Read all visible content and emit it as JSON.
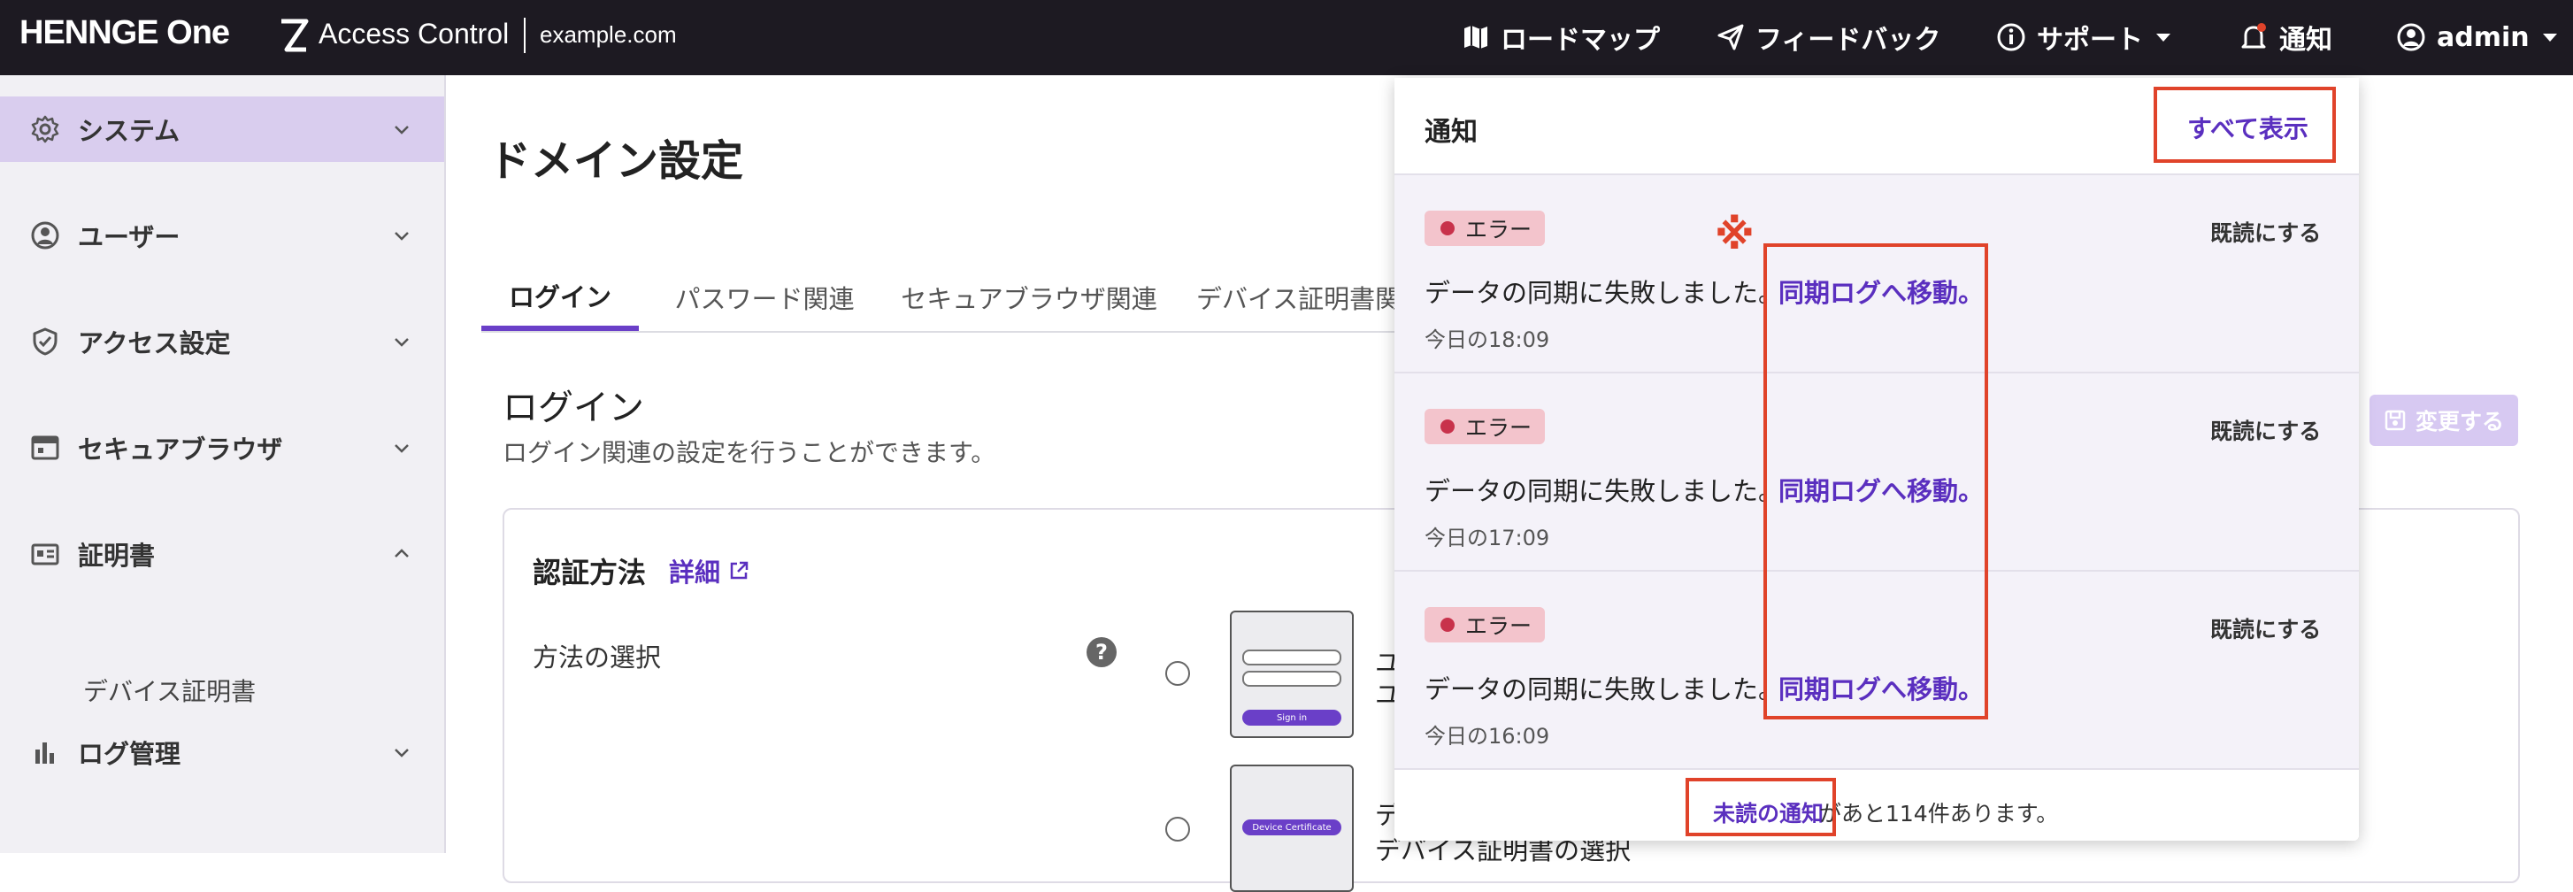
{
  "header": {
    "logo": "HENNGE One",
    "app_name": "Access Control",
    "domain": "example.com",
    "roadmap": "ロードマップ",
    "feedback": "フィードバック",
    "support": "サポート",
    "notifications": "通知",
    "user": "admin"
  },
  "sidebar": {
    "items": [
      {
        "label": "システム",
        "icon": "gear-icon"
      },
      {
        "label": "ユーザー",
        "icon": "user-circle-icon"
      },
      {
        "label": "アクセス設定",
        "icon": "shield-check-icon"
      },
      {
        "label": "セキュアブラウザ",
        "icon": "browser-window-icon"
      },
      {
        "label": "証明書",
        "icon": "id-card-icon"
      },
      {
        "label": "ログ管理",
        "icon": "bar-chart-icon"
      }
    ],
    "sub_item": "デバイス証明書"
  },
  "main": {
    "page_title": "ドメイン設定",
    "tabs": [
      "ログイン",
      "パスワード関連",
      "セキュアブラウザ関連",
      "デバイス証明書関"
    ],
    "section_title": "ログイン",
    "section_desc": "ログイン関連の設定を行うことができます。",
    "save_button": "変更する",
    "auth_title": "認証方法",
    "auth_detail": "詳細",
    "method_label": "方法の選択",
    "help": "?",
    "thumb1_button": "Sign in",
    "thumb2_button": "Device Certificate",
    "method1_line1": "ユ",
    "method1_line2": "ユ",
    "method2_line1": "デ",
    "method2_line2": "デバイス証明書の選択"
  },
  "notifications": {
    "title": "通知",
    "show_all": "すべて表示",
    "items": [
      {
        "badge": "エラー",
        "mark_read": "既読にする",
        "message": "データの同期に失敗しました。",
        "link": "同期ログへ移動。",
        "time": "今日の18:09"
      },
      {
        "badge": "エラー",
        "mark_read": "既読にする",
        "message": "データの同期に失敗しました。",
        "link": "同期ログへ移動。",
        "time": "今日の17:09"
      },
      {
        "badge": "エラー",
        "mark_read": "既読にする",
        "message": "データの同期に失敗しました。",
        "link": "同期ログへ移動。",
        "time": "今日の16:09"
      }
    ],
    "footer_link": "未読の通知",
    "footer_rest": "があと114件あります。"
  },
  "annotation": {
    "mark": "※"
  },
  "colors": {
    "accent": "#5a2fbf",
    "error": "#c8324b",
    "annotation": "#e0432a",
    "topbar": "#1d1a22"
  }
}
